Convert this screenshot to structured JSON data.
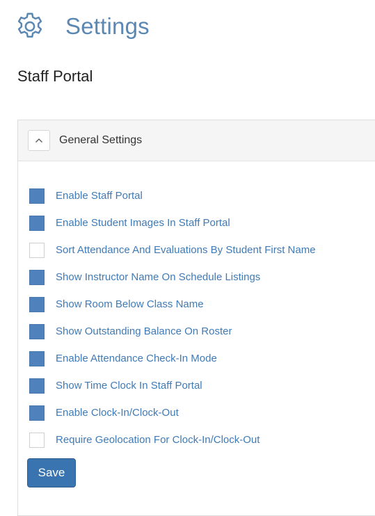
{
  "page": {
    "title": "Settings",
    "icon": "gear-icon",
    "accent_color": "#5b87b3"
  },
  "section": {
    "title": "Staff Portal"
  },
  "panel": {
    "title": "General Settings",
    "collapse_icon": "chevron-up-icon",
    "expanded": true
  },
  "settings": [
    {
      "label": "Enable Staff Portal",
      "checked": true
    },
    {
      "label": "Enable Student Images In Staff Portal",
      "checked": true
    },
    {
      "label": "Sort Attendance And Evaluations By Student First Name",
      "checked": false
    },
    {
      "label": "Show Instructor Name On Schedule Listings",
      "checked": true
    },
    {
      "label": "Show Room Below Class Name",
      "checked": true
    },
    {
      "label": "Show Outstanding Balance On Roster",
      "checked": true
    },
    {
      "label": "Enable Attendance Check-In Mode",
      "checked": true
    },
    {
      "label": "Show Time Clock In Staff Portal",
      "checked": true
    },
    {
      "label": "Enable Clock-In/Clock-Out",
      "checked": true
    },
    {
      "label": "Require Geolocation For Clock-In/Clock-Out",
      "checked": false
    }
  ],
  "actions": {
    "save_label": "Save",
    "save_color": "#3a74b0"
  },
  "colors": {
    "checkbox_checked": "#4f81bd",
    "label_link": "#3f7ab6"
  }
}
